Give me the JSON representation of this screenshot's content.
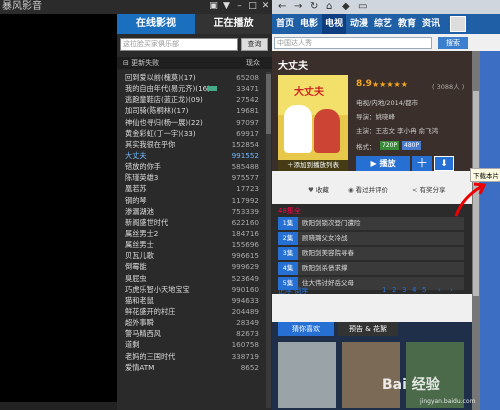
{
  "window": {
    "title": "暴风影音"
  },
  "sidebar": {
    "tabs": [
      "在线影视",
      "正在播放"
    ],
    "search_placeholder": "这拉脸买家俱乐部",
    "search_button": "查询",
    "sort_label": "更新失败",
    "sort_right": "现众",
    "items": [
      {
        "name": "回到爱以前(槐莫)(17)",
        "count": "65208"
      },
      {
        "name": "我的自由年代(易元齐)(16)",
        "count": "33471",
        "hd": true
      },
      {
        "name": "逃跑童鞋店(蓝正龙)(09)",
        "count": "27542"
      },
      {
        "name": "加司骑(陈桐林)(17)",
        "count": "19681"
      },
      {
        "name": "神仙也寻归(杨一展)(22)",
        "count": "97097"
      },
      {
        "name": "黄金彩虹(丁一宇)(33)",
        "count": "69917"
      },
      {
        "name": "其实我很在乎你",
        "count": "152854"
      },
      {
        "name": "大丈夫",
        "count": "991552",
        "selected": true
      },
      {
        "name": "错放的你手",
        "count": "585488"
      },
      {
        "name": "陈瑾英雄3",
        "count": "975577"
      },
      {
        "name": "凰若苏",
        "count": "17723"
      },
      {
        "name": "钢的琴",
        "count": "117992"
      },
      {
        "name": "渗漏湖池",
        "count": "753339"
      },
      {
        "name": "新阁盛世时代",
        "count": "622160"
      },
      {
        "name": "属丝男士2",
        "count": "184716"
      },
      {
        "name": "属丝男士",
        "count": "155696"
      },
      {
        "name": "贝瓦儿歌",
        "count": "996615"
      },
      {
        "name": "倒霉能",
        "count": "999629"
      },
      {
        "name": "臭屁虫",
        "count": "523649"
      },
      {
        "name": "巧虎乐智小天地宝宝",
        "count": "990160"
      },
      {
        "name": "猫和老鼠",
        "count": "994633"
      },
      {
        "name": "鲜花盛开的村庄",
        "count": "204489"
      },
      {
        "name": "超外事瞬",
        "count": "28349"
      },
      {
        "name": "警马精西风",
        "count": "82673"
      },
      {
        "name": "道剩",
        "count": "160758"
      },
      {
        "name": "老妈的三国时代",
        "count": "338719"
      },
      {
        "name": "爱情ATM",
        "count": "8652"
      }
    ]
  },
  "panel": {
    "nav_icons": [
      "back-icon",
      "forward-icon",
      "refresh-icon",
      "home-icon",
      "fav-icon",
      "window-icon"
    ],
    "categories": [
      "首页",
      "电影",
      "电视",
      "动漫",
      "综艺",
      "教育",
      "资讯"
    ],
    "active_category": "电视",
    "search_placeholder": "中国达人秀",
    "search_button": "搜索",
    "detail": {
      "title": "大丈夫",
      "rating": "8.9",
      "stars": "★★★★★",
      "votes": "( 3088人 )",
      "genre": "电视/内地/2014/都市",
      "director": "导演：姚晓峰",
      "cast": "主演：王志文 李小冉 俞飞鸿",
      "format_label": "格式：",
      "badge1": "720P",
      "badge2": "480P",
      "poster_text": "大丈夫",
      "add_to_list": "＋添加到播放列表",
      "play_label": "▶ 播放",
      "plus_label": "＋",
      "download_label": "⬇"
    },
    "actions": [
      {
        "icon": "heart-icon",
        "label": "收藏"
      },
      {
        "icon": "eye-icon",
        "label": "看过并评价"
      },
      {
        "icon": "share-icon",
        "label": "有奖分享"
      }
    ],
    "episodes": {
      "header": "48集全",
      "items": [
        {
          "num": "1集",
          "title": "欧阳剑锁次登门遭险"
        },
        {
          "num": "2集",
          "title": "顾晓璐父女冷战"
        },
        {
          "num": "3集",
          "title": "欧阳剑美容院寻春"
        },
        {
          "num": "4集",
          "title": "欧阳剑杀债求撑"
        },
        {
          "num": "5集",
          "title": "住大伟讨好岳父母"
        }
      ],
      "sort_label": "正序 倒序",
      "pages": [
        "1",
        "2",
        "3",
        "4",
        "5"
      ],
      "prev": "‹",
      "next": "›"
    },
    "recommend": {
      "tabs": [
        "猜你喜欢",
        "预告 & 花絮"
      ]
    }
  },
  "annotation": "下载本片",
  "watermark": "Bai 经验",
  "watermark_sub": "jingyan.baidu.com"
}
